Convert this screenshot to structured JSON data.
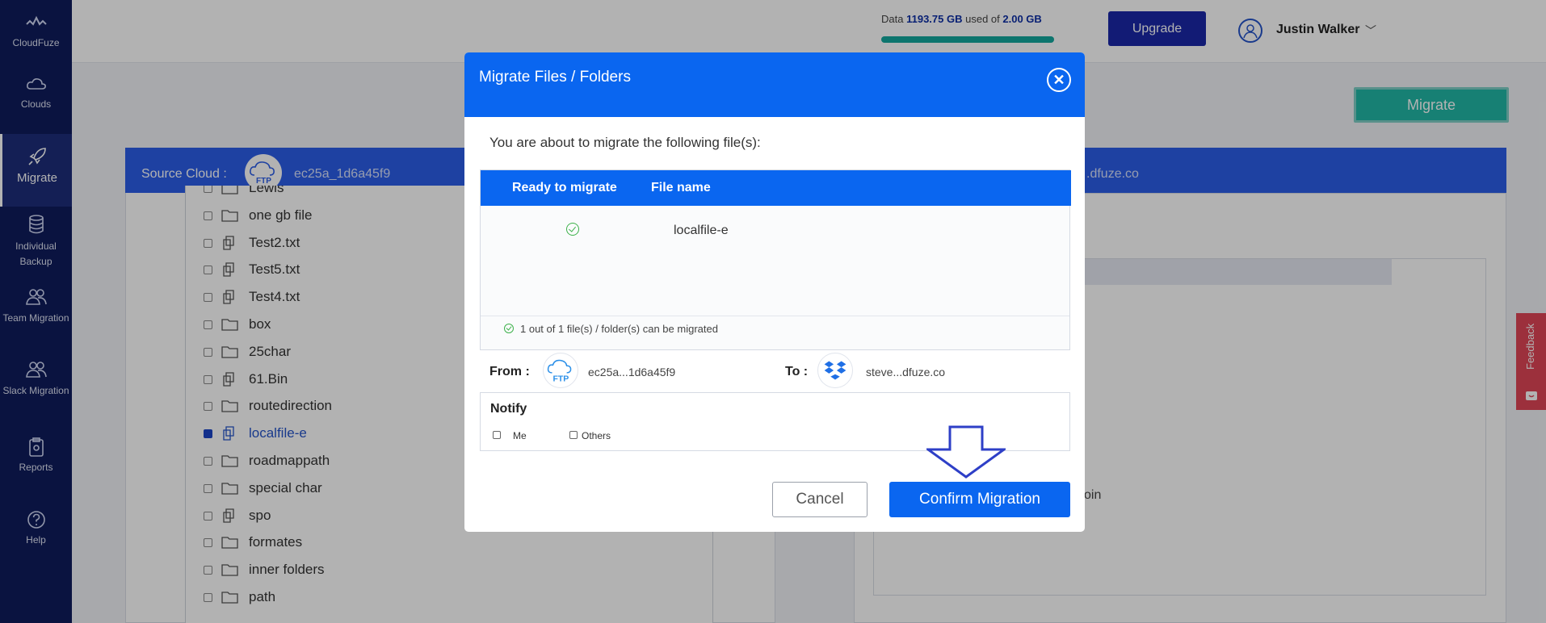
{
  "sidebar": {
    "brand": "CloudFuze",
    "items": [
      {
        "label": "Clouds",
        "icon": "cloud-icon"
      },
      {
        "label": "Migrate",
        "icon": "rocket-icon"
      },
      {
        "label": "Individual Backup",
        "icon": "database-icon"
      },
      {
        "label": "Team Migration",
        "icon": "users-icon"
      },
      {
        "label": "Slack Migration",
        "icon": "users-icon"
      },
      {
        "label": "Reports",
        "icon": "clipboard-icon"
      },
      {
        "label": "Help",
        "icon": "help-icon"
      }
    ]
  },
  "header": {
    "data_prefix": "Data",
    "data_used": "1193.75 GB",
    "data_mid": "used of",
    "data_total": "2.00 GB",
    "usage_fraction": 1.0,
    "upgrade_label": "Upgrade",
    "user_name": "Justin Walker",
    "caret": "﹀"
  },
  "background": {
    "migrate_label": "Migrate",
    "source_label": "Source Cloud :",
    "source_id": "ec25a_1d6a45f9",
    "dest_id_tail": ".dfuze.co",
    "dest_item_tail": "oin",
    "files": [
      {
        "name": "Lewis",
        "type": "folder"
      },
      {
        "name": "one gb file",
        "type": "folder"
      },
      {
        "name": "Test2.txt",
        "type": "file"
      },
      {
        "name": "Test5.txt",
        "type": "file"
      },
      {
        "name": "Test4.txt",
        "type": "file"
      },
      {
        "name": "box",
        "type": "folder"
      },
      {
        "name": "25char",
        "type": "folder"
      },
      {
        "name": "61.Bin",
        "type": "file"
      },
      {
        "name": "routedirection",
        "type": "folder"
      },
      {
        "name": "localfile-e",
        "type": "file",
        "checked": true
      },
      {
        "name": "roadmappath",
        "type": "folder"
      },
      {
        "name": "special char",
        "type": "folder"
      },
      {
        "name": "spo",
        "type": "file"
      },
      {
        "name": "formates",
        "type": "folder"
      },
      {
        "name": "inner folders",
        "type": "folder"
      },
      {
        "name": "path",
        "type": "folder"
      }
    ],
    "feedback_label": "Feedback"
  },
  "modal": {
    "title": "Migrate Files / Folders",
    "close_icon": "close-icon",
    "intro": "You are about to migrate the following file(s):",
    "col_ready": "Ready to migrate",
    "col_file": "File name",
    "rows": [
      {
        "file": "localfile-e",
        "status": "ready"
      }
    ],
    "summary": "1 out of 1 file(s) / folder(s) can be migrated",
    "from_label": "From :",
    "from_id": "ec25a...1d6a45f9",
    "from_icon_text": "FTP",
    "to_label": "To :",
    "to_id": "steve...dfuze.co",
    "notify_title": "Notify",
    "notify_me": "Me",
    "notify_others": "Others",
    "cancel_label": "Cancel",
    "confirm_label": "Confirm Migration"
  },
  "colors": {
    "sidebar": "#0f1c5c",
    "primary": "#0a66f0",
    "upgrade": "#1a28a8",
    "teal": "#22b8a6",
    "feedback": "#e04657",
    "check_green": "#3cb14a"
  }
}
